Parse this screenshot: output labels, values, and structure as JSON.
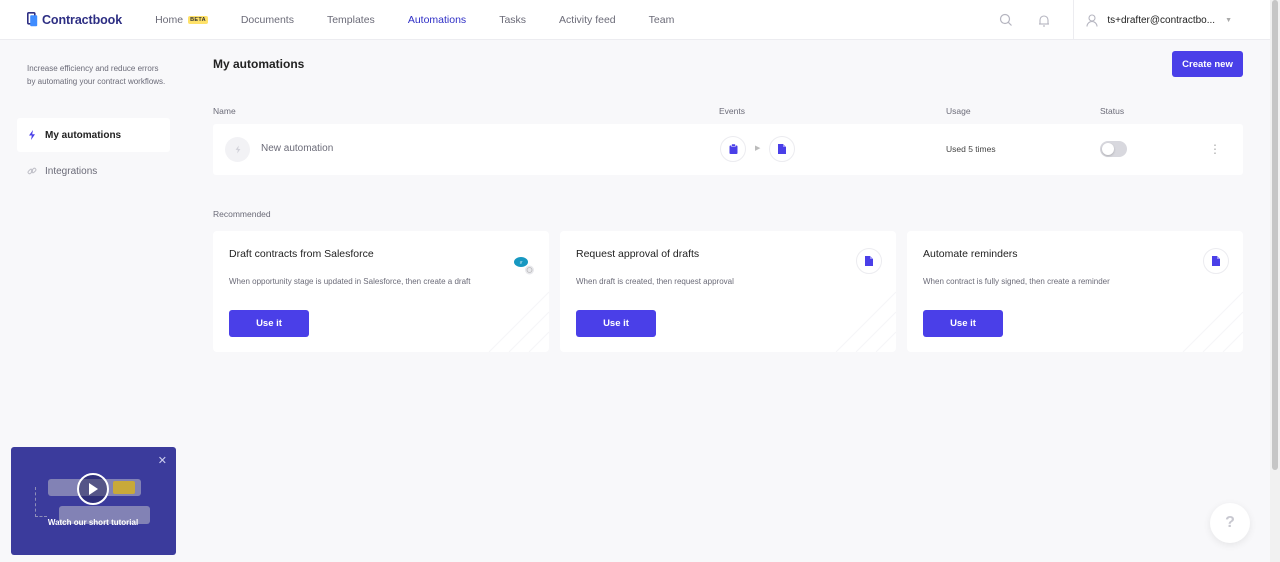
{
  "header": {
    "logo_text": "Contractbook",
    "nav": [
      {
        "label": "Home",
        "badge": "BETA"
      },
      {
        "label": "Documents"
      },
      {
        "label": "Templates"
      },
      {
        "label": "Automations",
        "active": true
      },
      {
        "label": "Tasks"
      },
      {
        "label": "Activity feed"
      },
      {
        "label": "Team"
      }
    ],
    "user_email": "ts+drafter@contractbo...",
    "icons": [
      "search-icon",
      "bell-icon",
      "user-icon",
      "chevron-down-icon"
    ]
  },
  "sidebar": {
    "description": "Increase efficiency and reduce errors by automating your contract workflows.",
    "items": [
      {
        "label": "My automations",
        "icon": "lightning-icon",
        "active": true
      },
      {
        "label": "Integrations",
        "icon": "link-icon",
        "active": false
      }
    ]
  },
  "main": {
    "title": "My automations",
    "create_label": "Create new",
    "columns": {
      "name": "Name",
      "events": "Events",
      "usage": "Usage",
      "status": "Status"
    },
    "automations": [
      {
        "name": "New automation",
        "usage": "Used 5 times",
        "status": "off",
        "events": [
          "clipboard-icon",
          "document-icon"
        ]
      }
    ],
    "recommended_label": "Recommended",
    "recommended": [
      {
        "title": "Draft contracts from Salesforce",
        "description": "When opportunity stage is updated in Salesforce, then create a draft",
        "button": "Use it",
        "icon": "salesforce-icon"
      },
      {
        "title": "Request approval of drafts",
        "description": "When draft is created, then request approval",
        "button": "Use it",
        "icon": "document-icon"
      },
      {
        "title": "Automate reminders",
        "description": "When contract is fully signed, then create a reminder",
        "button": "Use it",
        "icon": "document-icon"
      }
    ]
  },
  "tutorial": {
    "label": "Watch our short tutorial"
  },
  "help": {
    "label": "?"
  },
  "colors": {
    "brand": "#4a3fe8",
    "nav_active": "#2f2fc6",
    "logo": "#2d2e83",
    "tutorial_bg": "#3b3b9c"
  }
}
